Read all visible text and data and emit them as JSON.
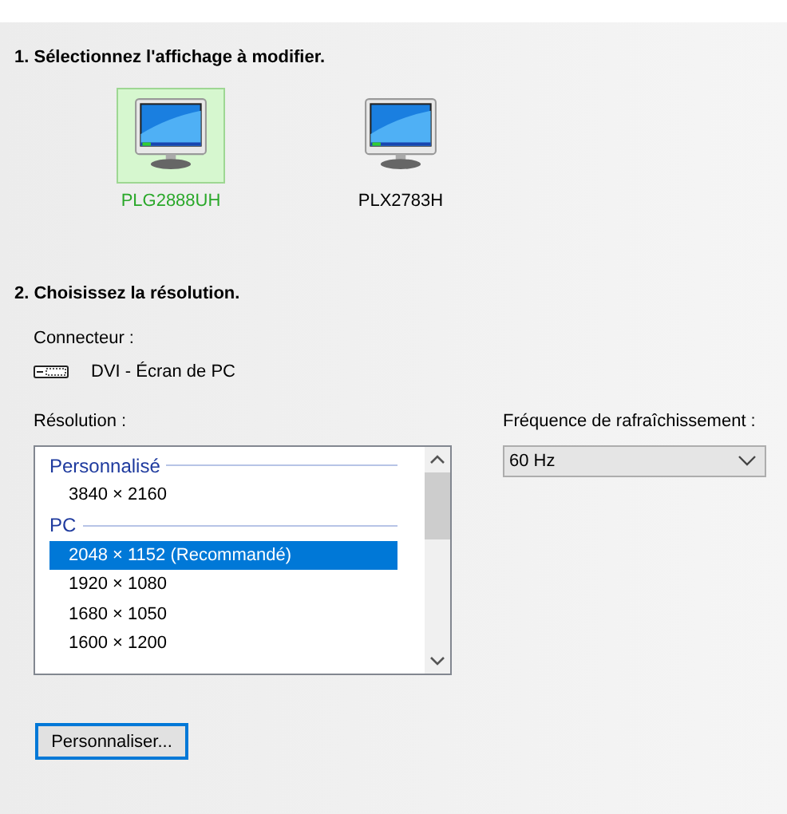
{
  "step1": {
    "heading": "1. Sélectionnez l'affichage à modifier.",
    "displays": [
      {
        "label": "PLG2888UH",
        "selected": true
      },
      {
        "label": "PLX2783H",
        "selected": false
      }
    ]
  },
  "step2": {
    "heading": "2. Choisissez la résolution.",
    "connector_label": "Connecteur :",
    "connector": "DVI - Écran de PC",
    "resolution_label": "Résolution :",
    "groups": [
      {
        "header": "Personnalisé",
        "items": [
          {
            "label": "3840 × 2160",
            "selected": false
          }
        ]
      },
      {
        "header": "PC",
        "items": [
          {
            "label": "2048 × 1152 (Recommandé)",
            "selected": true
          },
          {
            "label": "1920 × 1080",
            "selected": false
          },
          {
            "label": "1680 × 1050",
            "selected": false
          },
          {
            "label": "1600 × 1200",
            "selected": false
          }
        ]
      }
    ],
    "refresh_label": "Fréquence de rafraîchissement :",
    "refresh_value": "60 Hz",
    "customize_button": "Personnaliser..."
  }
}
